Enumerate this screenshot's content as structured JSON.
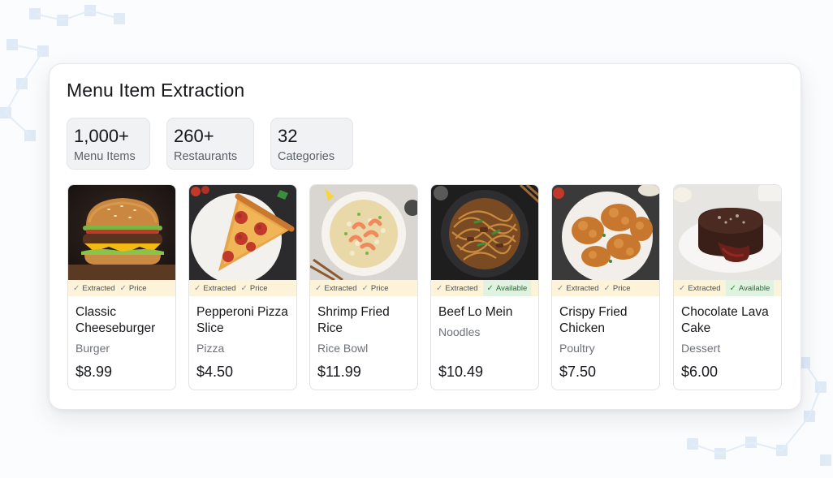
{
  "page": {
    "title": "Menu Item Extraction",
    "stats": [
      {
        "value": "1,000+",
        "label": "Menu Items"
      },
      {
        "value": "260+",
        "label": "Restaurants"
      },
      {
        "value": "32",
        "label": "Categories"
      }
    ],
    "items": [
      {
        "name": "Classic Cheeseburger",
        "category": "Burger",
        "price": "$8.99",
        "tags": [
          "Extracted",
          "Price"
        ],
        "image": "cheeseburger-photo"
      },
      {
        "name": "Pepperoni Pizza Slice",
        "category": "Pizza",
        "price": "$4.50",
        "tags": [
          "Extracted",
          "Price"
        ],
        "image": "pizza-slice-photo"
      },
      {
        "name": "Shrimp Fried Rice",
        "category": "Rice Bowl",
        "price": "$11.99",
        "tags": [
          "Extracted",
          "Price"
        ],
        "image": "shrimp-fried-rice-photo"
      },
      {
        "name": "Beef Lo Mein",
        "category": "Noodles",
        "price": "$10.49",
        "tags": [
          "Extracted",
          "Available"
        ],
        "image": "lo-mein-photo"
      },
      {
        "name": "Crispy Fried Chicken",
        "category": "Poultry",
        "price": "$7.50",
        "tags": [
          "Extracted",
          "Price"
        ],
        "image": "fried-chicken-photo"
      },
      {
        "name": "Chocolate Lava Cake",
        "category": "Dessert",
        "price": "$6.00",
        "tags": [
          "Extracted",
          "Available"
        ],
        "image": "lava-cake-photo"
      }
    ]
  },
  "colors": {
    "tag_bar": "#fdf3d8",
    "available_badge": "#dff3e0",
    "stat_box": "#f1f2f4"
  }
}
